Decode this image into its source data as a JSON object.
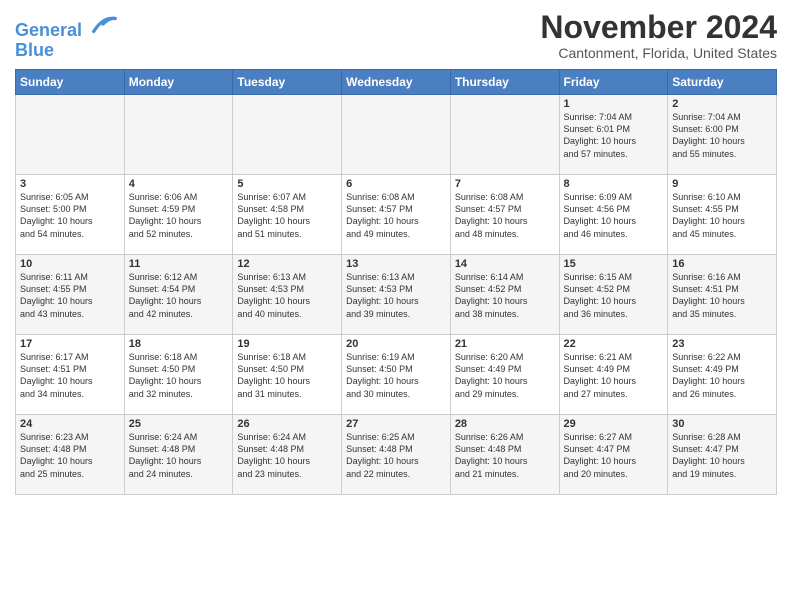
{
  "header": {
    "logo_line1": "General",
    "logo_line2": "Blue",
    "month_title": "November 2024",
    "subtitle": "Cantonment, Florida, United States"
  },
  "weekdays": [
    "Sunday",
    "Monday",
    "Tuesday",
    "Wednesday",
    "Thursday",
    "Friday",
    "Saturday"
  ],
  "weeks": [
    [
      {
        "day": "",
        "info": ""
      },
      {
        "day": "",
        "info": ""
      },
      {
        "day": "",
        "info": ""
      },
      {
        "day": "",
        "info": ""
      },
      {
        "day": "",
        "info": ""
      },
      {
        "day": "1",
        "info": "Sunrise: 7:04 AM\nSunset: 6:01 PM\nDaylight: 10 hours\nand 57 minutes."
      },
      {
        "day": "2",
        "info": "Sunrise: 7:04 AM\nSunset: 6:00 PM\nDaylight: 10 hours\nand 55 minutes."
      }
    ],
    [
      {
        "day": "3",
        "info": "Sunrise: 6:05 AM\nSunset: 5:00 PM\nDaylight: 10 hours\nand 54 minutes."
      },
      {
        "day": "4",
        "info": "Sunrise: 6:06 AM\nSunset: 4:59 PM\nDaylight: 10 hours\nand 52 minutes."
      },
      {
        "day": "5",
        "info": "Sunrise: 6:07 AM\nSunset: 4:58 PM\nDaylight: 10 hours\nand 51 minutes."
      },
      {
        "day": "6",
        "info": "Sunrise: 6:08 AM\nSunset: 4:57 PM\nDaylight: 10 hours\nand 49 minutes."
      },
      {
        "day": "7",
        "info": "Sunrise: 6:08 AM\nSunset: 4:57 PM\nDaylight: 10 hours\nand 48 minutes."
      },
      {
        "day": "8",
        "info": "Sunrise: 6:09 AM\nSunset: 4:56 PM\nDaylight: 10 hours\nand 46 minutes."
      },
      {
        "day": "9",
        "info": "Sunrise: 6:10 AM\nSunset: 4:55 PM\nDaylight: 10 hours\nand 45 minutes."
      }
    ],
    [
      {
        "day": "10",
        "info": "Sunrise: 6:11 AM\nSunset: 4:55 PM\nDaylight: 10 hours\nand 43 minutes."
      },
      {
        "day": "11",
        "info": "Sunrise: 6:12 AM\nSunset: 4:54 PM\nDaylight: 10 hours\nand 42 minutes."
      },
      {
        "day": "12",
        "info": "Sunrise: 6:13 AM\nSunset: 4:53 PM\nDaylight: 10 hours\nand 40 minutes."
      },
      {
        "day": "13",
        "info": "Sunrise: 6:13 AM\nSunset: 4:53 PM\nDaylight: 10 hours\nand 39 minutes."
      },
      {
        "day": "14",
        "info": "Sunrise: 6:14 AM\nSunset: 4:52 PM\nDaylight: 10 hours\nand 38 minutes."
      },
      {
        "day": "15",
        "info": "Sunrise: 6:15 AM\nSunset: 4:52 PM\nDaylight: 10 hours\nand 36 minutes."
      },
      {
        "day": "16",
        "info": "Sunrise: 6:16 AM\nSunset: 4:51 PM\nDaylight: 10 hours\nand 35 minutes."
      }
    ],
    [
      {
        "day": "17",
        "info": "Sunrise: 6:17 AM\nSunset: 4:51 PM\nDaylight: 10 hours\nand 34 minutes."
      },
      {
        "day": "18",
        "info": "Sunrise: 6:18 AM\nSunset: 4:50 PM\nDaylight: 10 hours\nand 32 minutes."
      },
      {
        "day": "19",
        "info": "Sunrise: 6:18 AM\nSunset: 4:50 PM\nDaylight: 10 hours\nand 31 minutes."
      },
      {
        "day": "20",
        "info": "Sunrise: 6:19 AM\nSunset: 4:50 PM\nDaylight: 10 hours\nand 30 minutes."
      },
      {
        "day": "21",
        "info": "Sunrise: 6:20 AM\nSunset: 4:49 PM\nDaylight: 10 hours\nand 29 minutes."
      },
      {
        "day": "22",
        "info": "Sunrise: 6:21 AM\nSunset: 4:49 PM\nDaylight: 10 hours\nand 27 minutes."
      },
      {
        "day": "23",
        "info": "Sunrise: 6:22 AM\nSunset: 4:49 PM\nDaylight: 10 hours\nand 26 minutes."
      }
    ],
    [
      {
        "day": "24",
        "info": "Sunrise: 6:23 AM\nSunset: 4:48 PM\nDaylight: 10 hours\nand 25 minutes."
      },
      {
        "day": "25",
        "info": "Sunrise: 6:24 AM\nSunset: 4:48 PM\nDaylight: 10 hours\nand 24 minutes."
      },
      {
        "day": "26",
        "info": "Sunrise: 6:24 AM\nSunset: 4:48 PM\nDaylight: 10 hours\nand 23 minutes."
      },
      {
        "day": "27",
        "info": "Sunrise: 6:25 AM\nSunset: 4:48 PM\nDaylight: 10 hours\nand 22 minutes."
      },
      {
        "day": "28",
        "info": "Sunrise: 6:26 AM\nSunset: 4:48 PM\nDaylight: 10 hours\nand 21 minutes."
      },
      {
        "day": "29",
        "info": "Sunrise: 6:27 AM\nSunset: 4:47 PM\nDaylight: 10 hours\nand 20 minutes."
      },
      {
        "day": "30",
        "info": "Sunrise: 6:28 AM\nSunset: 4:47 PM\nDaylight: 10 hours\nand 19 minutes."
      }
    ]
  ]
}
